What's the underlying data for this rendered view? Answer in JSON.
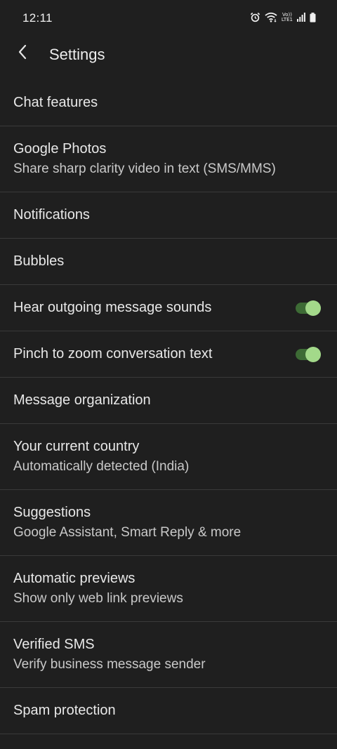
{
  "status_bar": {
    "time": "12:11",
    "icons": [
      "alarm-icon",
      "wifi-icon",
      "volte-indicator",
      "signal-icon",
      "battery-icon"
    ],
    "volte_top": "Vo))",
    "volte_bottom": "LTE1"
  },
  "header": {
    "back_icon": "chevron-left-icon",
    "title": "Settings"
  },
  "colors": {
    "background": "#1f1f1f",
    "divider": "#3a3a3a",
    "toggle_track_on": "#3d6b35",
    "toggle_thumb_on": "#a3d98a"
  },
  "items": [
    {
      "title": "Chat features"
    },
    {
      "title": "Google Photos",
      "subtitle": "Share sharp clarity video in text (SMS/MMS)"
    },
    {
      "title": "Notifications"
    },
    {
      "title": "Bubbles"
    },
    {
      "title": "Hear outgoing message sounds",
      "toggle": true
    },
    {
      "title": "Pinch to zoom conversation text",
      "toggle": true
    },
    {
      "title": "Message organization"
    },
    {
      "title": "Your current country",
      "subtitle": "Automatically detected (India)"
    },
    {
      "title": "Suggestions",
      "subtitle": "Google Assistant, Smart Reply & more"
    },
    {
      "title": "Automatic previews",
      "subtitle": "Show only web link previews"
    },
    {
      "title": "Verified SMS",
      "subtitle": "Verify business message sender"
    },
    {
      "title": "Spam protection"
    }
  ]
}
